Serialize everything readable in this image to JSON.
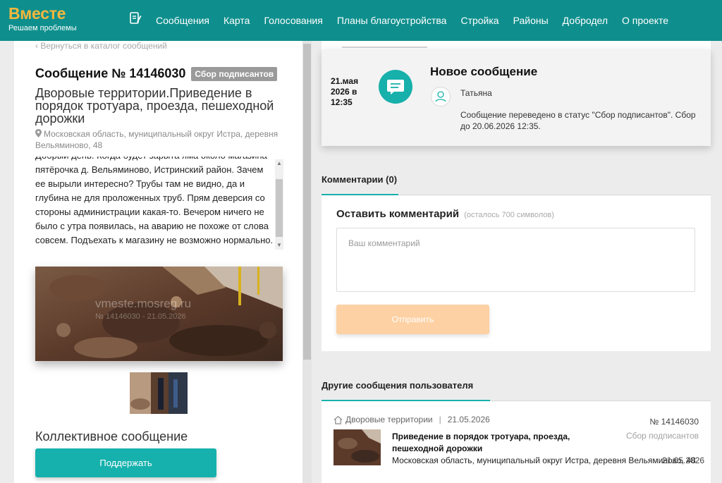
{
  "header": {
    "logo_title": "Вместе",
    "logo_subtitle": "Решаем проблемы",
    "nav": [
      "Сообщения",
      "Карта",
      "Голосования",
      "Планы благоустройства",
      "Стройка",
      "Районы",
      "Добродел",
      "О проекте"
    ],
    "bg_color": "#0e8f8d",
    "logo_color": "#f6b73c"
  },
  "message": {
    "back_link": "‹  Вернуться в каталог сообщений",
    "title": "Сообщение № 14146030",
    "status": "Сбор подписантов",
    "category": "Дворовые территории.Приведение в порядок тротуара, проезда, пешеходной дорожки",
    "address": "Московская область, муниципальный округ Истра, деревня Вельяминово, 48",
    "description": "Добрый день. Когда будет зарыта яма около магазина пятёрочка д. Вельяминово, Истринский район. Зачем ее вырыли интересно? Трубы там не видно, да и глубина не для проложенных труб. Прям деверсия со стороны администрации какая-то. Вечером ничего не было с утра появилась, на аварию не похоже от слова совсем. Подъехать к магазину не возможно нормально.",
    "photo_watermark": "vmeste.mosreg.ru",
    "photo_watermark_id": "№ 14146030 - 21.05.2026",
    "collective_label": "Коллективное сообщение",
    "support_button": "Поддержать"
  },
  "event": {
    "date": "21.мая 2026 в 12:35",
    "title": "Новое сообщение",
    "author": "Татьяна",
    "text": "Сообщение переведено в статус \"Сбор подписантов\". Сбор до 20.06.2026 12:35."
  },
  "comments": {
    "header": "Комментарии (0)",
    "form_title": "Оставить комментарий",
    "form_hint": "(осталось 700 символов)",
    "placeholder": "Ваш комментарий",
    "send_button": "Отправить"
  },
  "other": {
    "header": "Другие сообщения пользователя",
    "items": [
      {
        "category": "Дворовые территории",
        "date": "21.05.2026",
        "number": "№ 14146030",
        "status": "Сбор подписантов",
        "title": "Приведение в порядок тротуара, проезда, пешеходной дорожки",
        "address": "Московская область, муниципальный округ Истра, деревня Вельяминово, 48",
        "date2": "21.05.2026"
      }
    ]
  },
  "colors": {
    "accent": "#17b0ab",
    "send_disabled": "#fdd1a3",
    "badge_grey": "#9a9a9a"
  }
}
